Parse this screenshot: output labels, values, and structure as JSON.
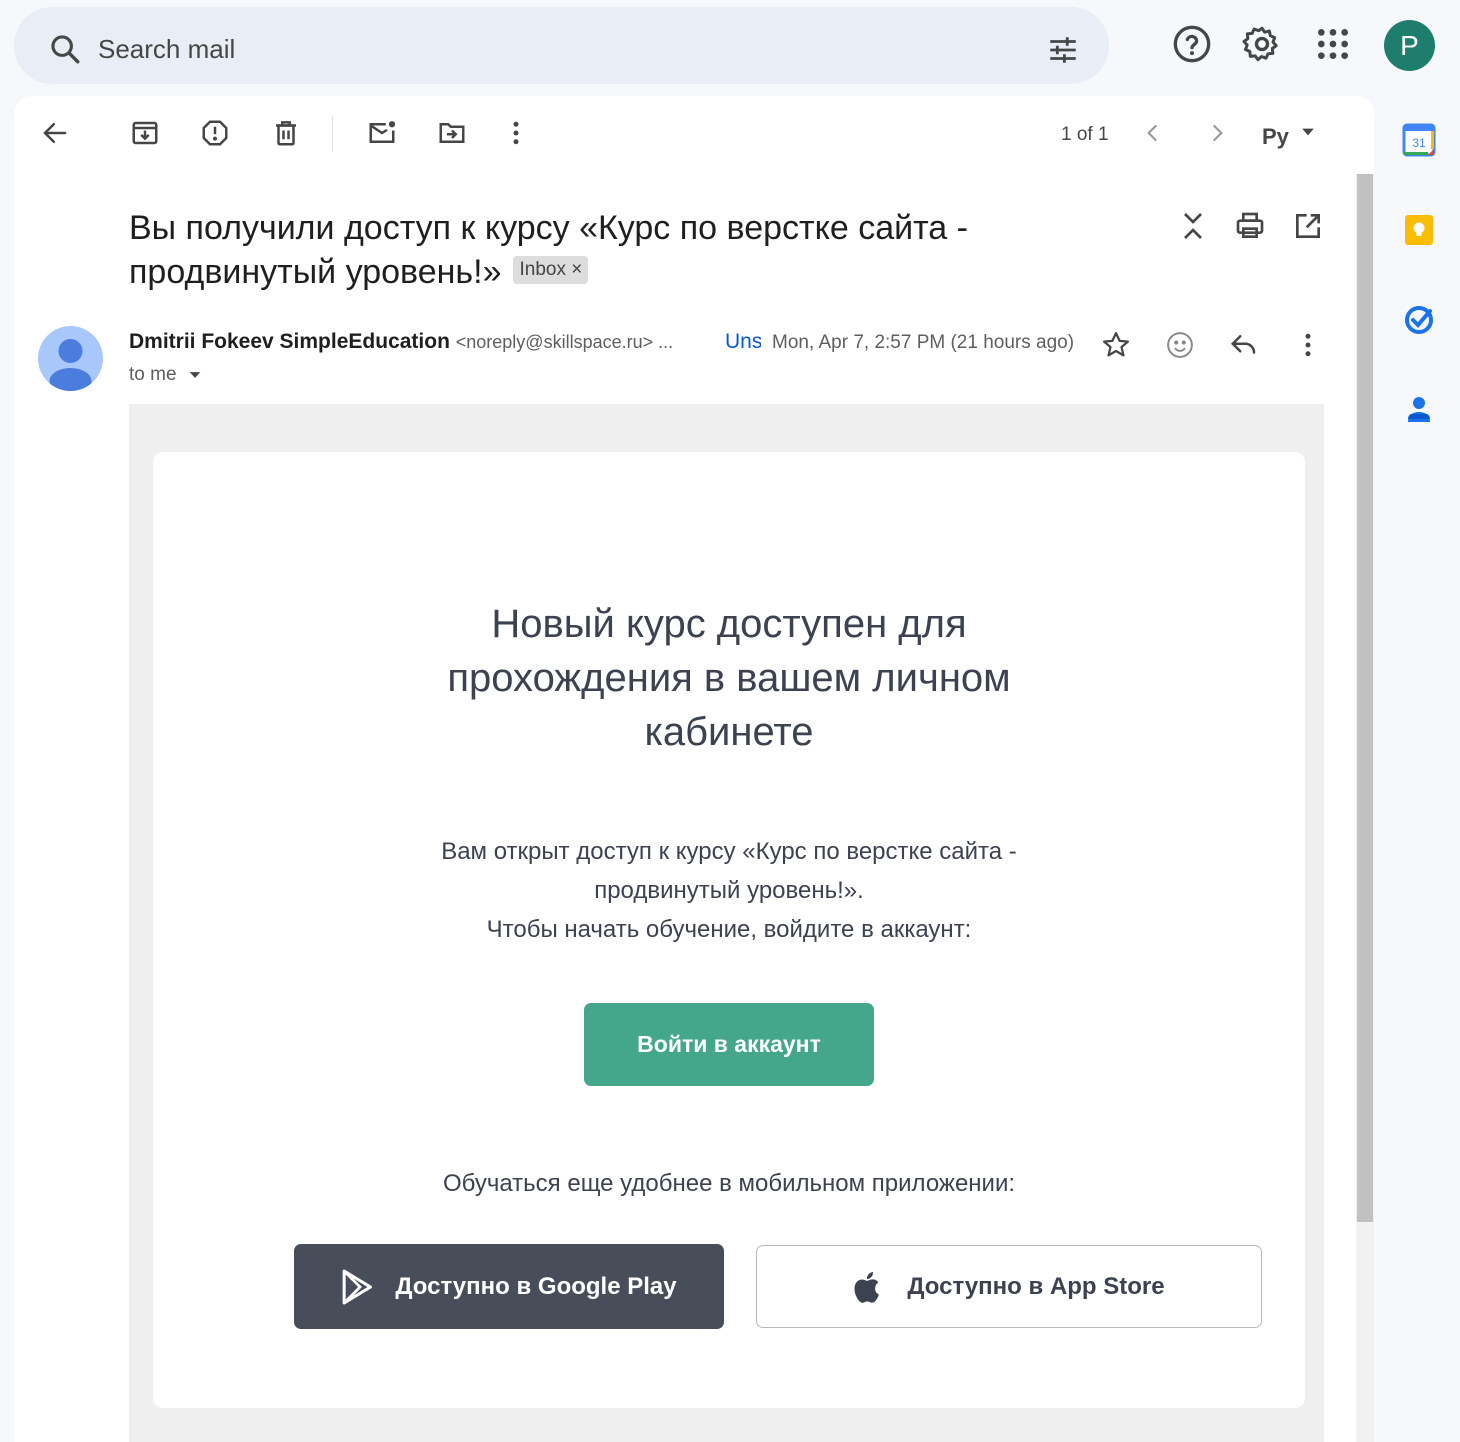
{
  "search": {
    "placeholder": "Search mail"
  },
  "account": {
    "initial": "P",
    "color": "#1e7d6c"
  },
  "toolbar": {
    "pager": "1 of 1",
    "language": "Ру"
  },
  "email": {
    "subject": "Вы получили доступ к курсу «Курс по верстке сайта - продвинутый уровень!»",
    "label_chip": "Inbox",
    "label_remove": "×",
    "sender_name": "Dmitrii Fokeev SimpleEducation",
    "sender_email": "<noreply@skillspace.ru> ...",
    "unsubscribe": "Unsubscribe",
    "date": "Mon, Apr 7, 2:57 PM (21 hours ago)",
    "recipient": "to me"
  },
  "body": {
    "heading": "Новый курс доступен для прохождения в вашем личном кабинете",
    "paragraph_line1": "Вам открыт доступ к курсу «Курс по верстке сайта -",
    "paragraph_line2": "продвинутый уровень!».",
    "paragraph_line3": "Чтобы начать обучение, войдите в аккаунт:",
    "login_button": "Войти в аккаунт",
    "app_text": "Обучаться еще удобнее в мобильном приложении:",
    "google_play_button": "Доступно в Google Play",
    "app_store_button": "Доступно в App Store"
  },
  "side_panel": {
    "calendar_day": "31"
  },
  "colors": {
    "accent_green": "#44a68b",
    "dark_button": "#474d59",
    "link_blue": "#0b57d0"
  }
}
